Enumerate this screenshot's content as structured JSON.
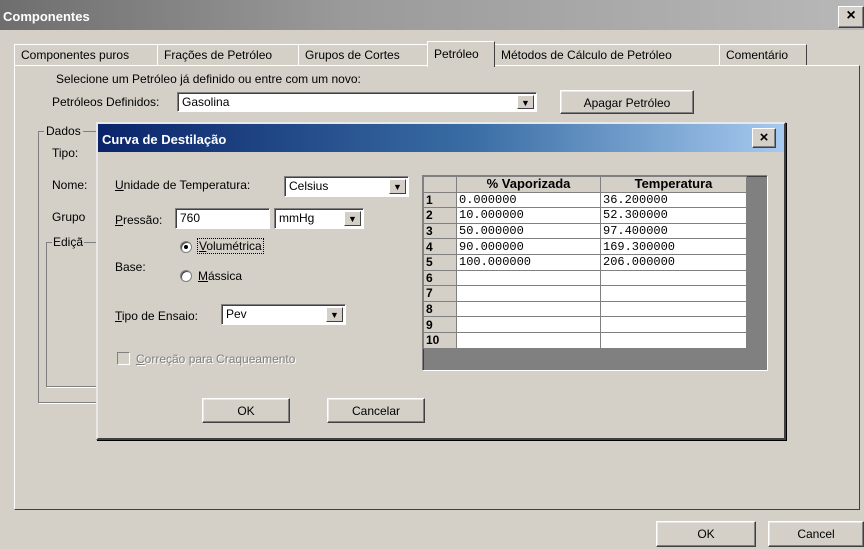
{
  "window": {
    "title": "Componentes",
    "close": "×"
  },
  "tabs": [
    {
      "label": "Componentes puros"
    },
    {
      "label": "Frações de Petróleo"
    },
    {
      "label": "Grupos de Cortes"
    },
    {
      "label": "Petróleo"
    },
    {
      "label": "Métodos de Cálculo de Petróleo"
    },
    {
      "label": "Comentário"
    }
  ],
  "petroleo": {
    "instruction": "Selecione um Petróleo já definido ou entre com um novo:",
    "defined_label": "Petróleos Definidos:",
    "defined_value": "Gasolina",
    "delete_button": "Apagar Petróleo",
    "group_dados": "Dados",
    "tipo_label": "Tipo:",
    "nome_label": "Nome:",
    "grupo_label": "Grupo",
    "edicao_label": "Ediçã"
  },
  "dialog": {
    "title": "Curva de Destilação",
    "close": "×",
    "temp_unit_label": "Unidade de Temperatura:",
    "temp_unit_value": "Celsius",
    "pressure_label": "Pressão:",
    "pressure_value": "760",
    "pressure_unit": "mmHg",
    "base_label": "Base:",
    "base_options": [
      {
        "label": "Volumétrica",
        "selected": true
      },
      {
        "label": "Mássica",
        "selected": false
      }
    ],
    "test_type_label": "Tipo de Ensaio:",
    "test_type_value": "Pev",
    "cracking_label": "Correção para Craqueamento",
    "cracking_checked": false,
    "ok_button": "OK",
    "cancel_button": "Cancelar",
    "table": {
      "headers": [
        "% Vaporizada",
        "Temperatura"
      ],
      "rows": [
        {
          "n": "1",
          "vap": "0.000000",
          "temp": "36.200000"
        },
        {
          "n": "2",
          "vap": "10.000000",
          "temp": "52.300000"
        },
        {
          "n": "3",
          "vap": "50.000000",
          "temp": "97.400000"
        },
        {
          "n": "4",
          "vap": "90.000000",
          "temp": "169.300000"
        },
        {
          "n": "5",
          "vap": "100.000000",
          "temp": "206.000000"
        },
        {
          "n": "6",
          "vap": "",
          "temp": ""
        },
        {
          "n": "7",
          "vap": "",
          "temp": ""
        },
        {
          "n": "8",
          "vap": "",
          "temp": ""
        },
        {
          "n": "9",
          "vap": "",
          "temp": ""
        },
        {
          "n": "10",
          "vap": "",
          "temp": ""
        }
      ]
    }
  },
  "footer": {
    "ok": "OK",
    "cancel": "Cancel"
  }
}
